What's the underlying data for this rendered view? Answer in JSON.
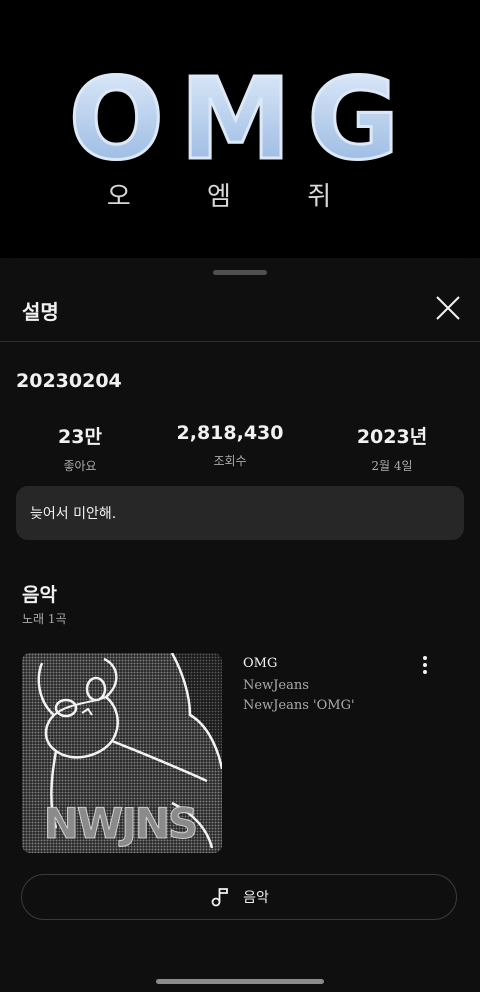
{
  "video": {
    "logo_text": "OMG",
    "logo_subtitle": "오 엠 쥐"
  },
  "sheet": {
    "title": "설명",
    "video_title": "20230204",
    "stats": [
      {
        "value": "23만",
        "label": "좋아요"
      },
      {
        "value": "2,818,430",
        "label": "조회수"
      },
      {
        "value": "2023년",
        "label": "2월 4일"
      }
    ],
    "description": "늦어서 미안해.",
    "music": {
      "heading": "음악",
      "subheading": "노래 1곡",
      "song_title": "OMG",
      "artist": "NewJeans",
      "album": "NewJeans 'OMG'",
      "art_text": "NWJNS",
      "button_label": "음악"
    }
  },
  "colors": {
    "background": "#0f0f0f",
    "card": "#272727",
    "logo_blue": "#a9c7ec"
  },
  "icons": {
    "close": "close-icon",
    "more": "more-vert-icon",
    "music": "music-note-icon"
  }
}
